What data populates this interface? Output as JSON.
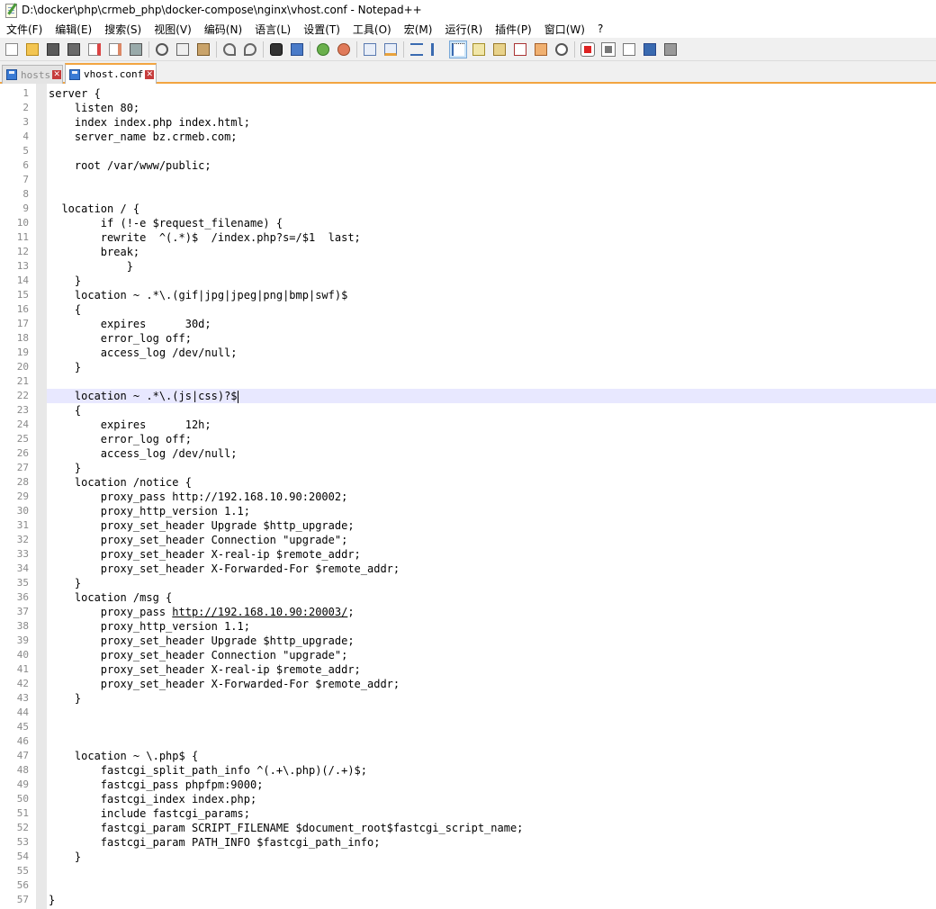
{
  "window": {
    "title": "D:\\docker\\php\\crmeb_php\\docker-compose\\nginx\\vhost.conf - Notepad++"
  },
  "menu": [
    "文件(F)",
    "编辑(E)",
    "搜索(S)",
    "视图(V)",
    "编码(N)",
    "语言(L)",
    "设置(T)",
    "工具(O)",
    "宏(M)",
    "运行(R)",
    "插件(P)",
    "窗口(W)",
    "?"
  ],
  "toolbar": {
    "icons": [
      "new-file-icon",
      "open-file-icon",
      "save-icon",
      "save-all-icon",
      "close-icon",
      "close-all-icon",
      "print-icon",
      "cut-icon",
      "copy-icon",
      "paste-icon",
      "undo-icon",
      "redo-icon",
      "find-icon",
      "replace-icon",
      "zoom-in-icon",
      "zoom-out-icon",
      "sync-vertical-icon",
      "sync-horizontal-icon",
      "word-wrap-icon",
      "show-all-chars-icon",
      "indent-guide-icon",
      "user-language-icon",
      "document-map-icon",
      "function-list-icon",
      "folder-as-workspace-icon",
      "monitoring-icon",
      "record-macro-icon",
      "stop-macro-icon",
      "play-macro-icon",
      "run-macro-multiple-icon",
      "save-macro-icon"
    ],
    "active_icon": "indent-guide-icon"
  },
  "tabs": [
    {
      "label": "hosts",
      "active": false
    },
    {
      "label": "vhost.conf",
      "active": true
    }
  ],
  "editor": {
    "current_line": 22,
    "lines": [
      "server {",
      "    listen 80;",
      "    index index.php index.html;",
      "    server_name bz.crmeb.com;",
      "",
      "    root /var/www/public;",
      "",
      "",
      "  location / {",
      "        if (!-e $request_filename) {",
      "        rewrite  ^(.*)$  /index.php?s=/$1  last;",
      "        break;",
      "            }",
      "    }",
      "    location ~ .*\\.(gif|jpg|jpeg|png|bmp|swf)$",
      "    {",
      "        expires      30d;",
      "        error_log off;",
      "        access_log /dev/null;",
      "    }",
      "",
      "    location ~ .*\\.(js|css)?$",
      "    {",
      "        expires      12h;",
      "        error_log off;",
      "        access_log /dev/null;",
      "    }",
      "    location /notice {",
      "        proxy_pass http://192.168.10.90:20002;",
      "        proxy_http_version 1.1;",
      "        proxy_set_header Upgrade $http_upgrade;",
      "        proxy_set_header Connection \"upgrade\";",
      "        proxy_set_header X-real-ip $remote_addr;",
      "        proxy_set_header X-Forwarded-For $remote_addr;",
      "    }",
      "    location /msg {",
      "        proxy_pass http://192.168.10.90:20003/;",
      "        proxy_http_version 1.1;",
      "        proxy_set_header Upgrade $http_upgrade;",
      "        proxy_set_header Connection \"upgrade\";",
      "        proxy_set_header X-real-ip $remote_addr;",
      "        proxy_set_header X-Forwarded-For $remote_addr;",
      "    }",
      "",
      "",
      "",
      "    location ~ \\.php$ {",
      "        fastcgi_split_path_info ^(.+\\.php)(/.+)$;",
      "        fastcgi_pass phpfpm:9000;",
      "        fastcgi_index index.php;",
      "        include fastcgi_params;",
      "        fastcgi_param SCRIPT_FILENAME $document_root$fastcgi_script_name;",
      "        fastcgi_param PATH_INFO $fastcgi_path_info;",
      "    }",
      "",
      "",
      "}"
    ]
  },
  "colors": {
    "tab_accent": "#f2a541",
    "current_line": "#e8e8ff",
    "line_number": "#8a8a8a",
    "gutter_margin": "#e8e8e8"
  }
}
